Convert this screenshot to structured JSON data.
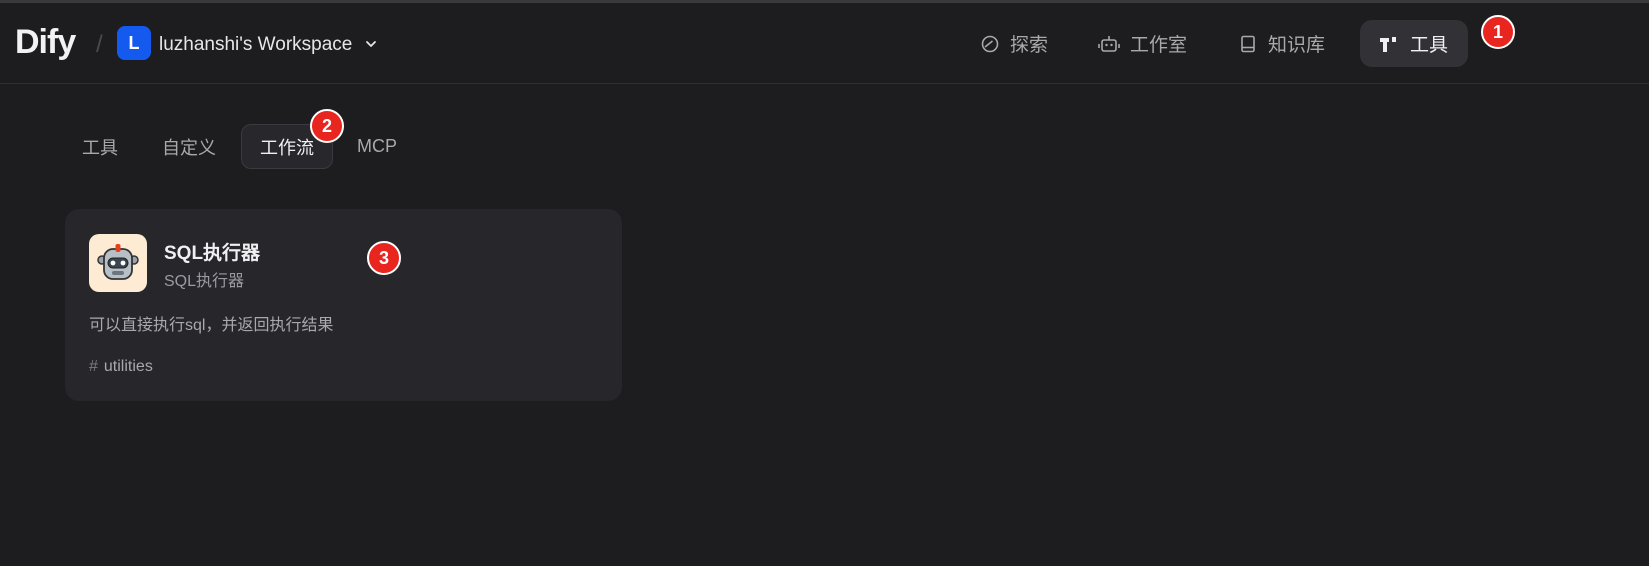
{
  "header": {
    "logo": "Dify",
    "separator": "/",
    "workspace_initial": "L",
    "workspace_name": "luzhanshi's Workspace",
    "nav": [
      {
        "label": "探索",
        "icon": "compass-icon"
      },
      {
        "label": "工作室",
        "icon": "robot-icon"
      },
      {
        "label": "知识库",
        "icon": "book-icon"
      },
      {
        "label": "工具",
        "icon": "tools-icon",
        "active": true
      }
    ]
  },
  "tabs": [
    {
      "label": "工具"
    },
    {
      "label": "自定义"
    },
    {
      "label": "工作流",
      "active": true
    },
    {
      "label": "MCP"
    }
  ],
  "tool_card": {
    "icon": "robot-avatar-icon",
    "title": "SQL执行器",
    "subtitle": "SQL执行器",
    "description": "可以直接执行sql，并返回执行结果",
    "tag_hash": "#",
    "tag": "utilities"
  },
  "annotations": [
    "1",
    "2",
    "3"
  ],
  "colors": {
    "accent": "#155aef",
    "badge": "#e8251f",
    "background": "#1d1d1f",
    "card": "#27272b"
  }
}
